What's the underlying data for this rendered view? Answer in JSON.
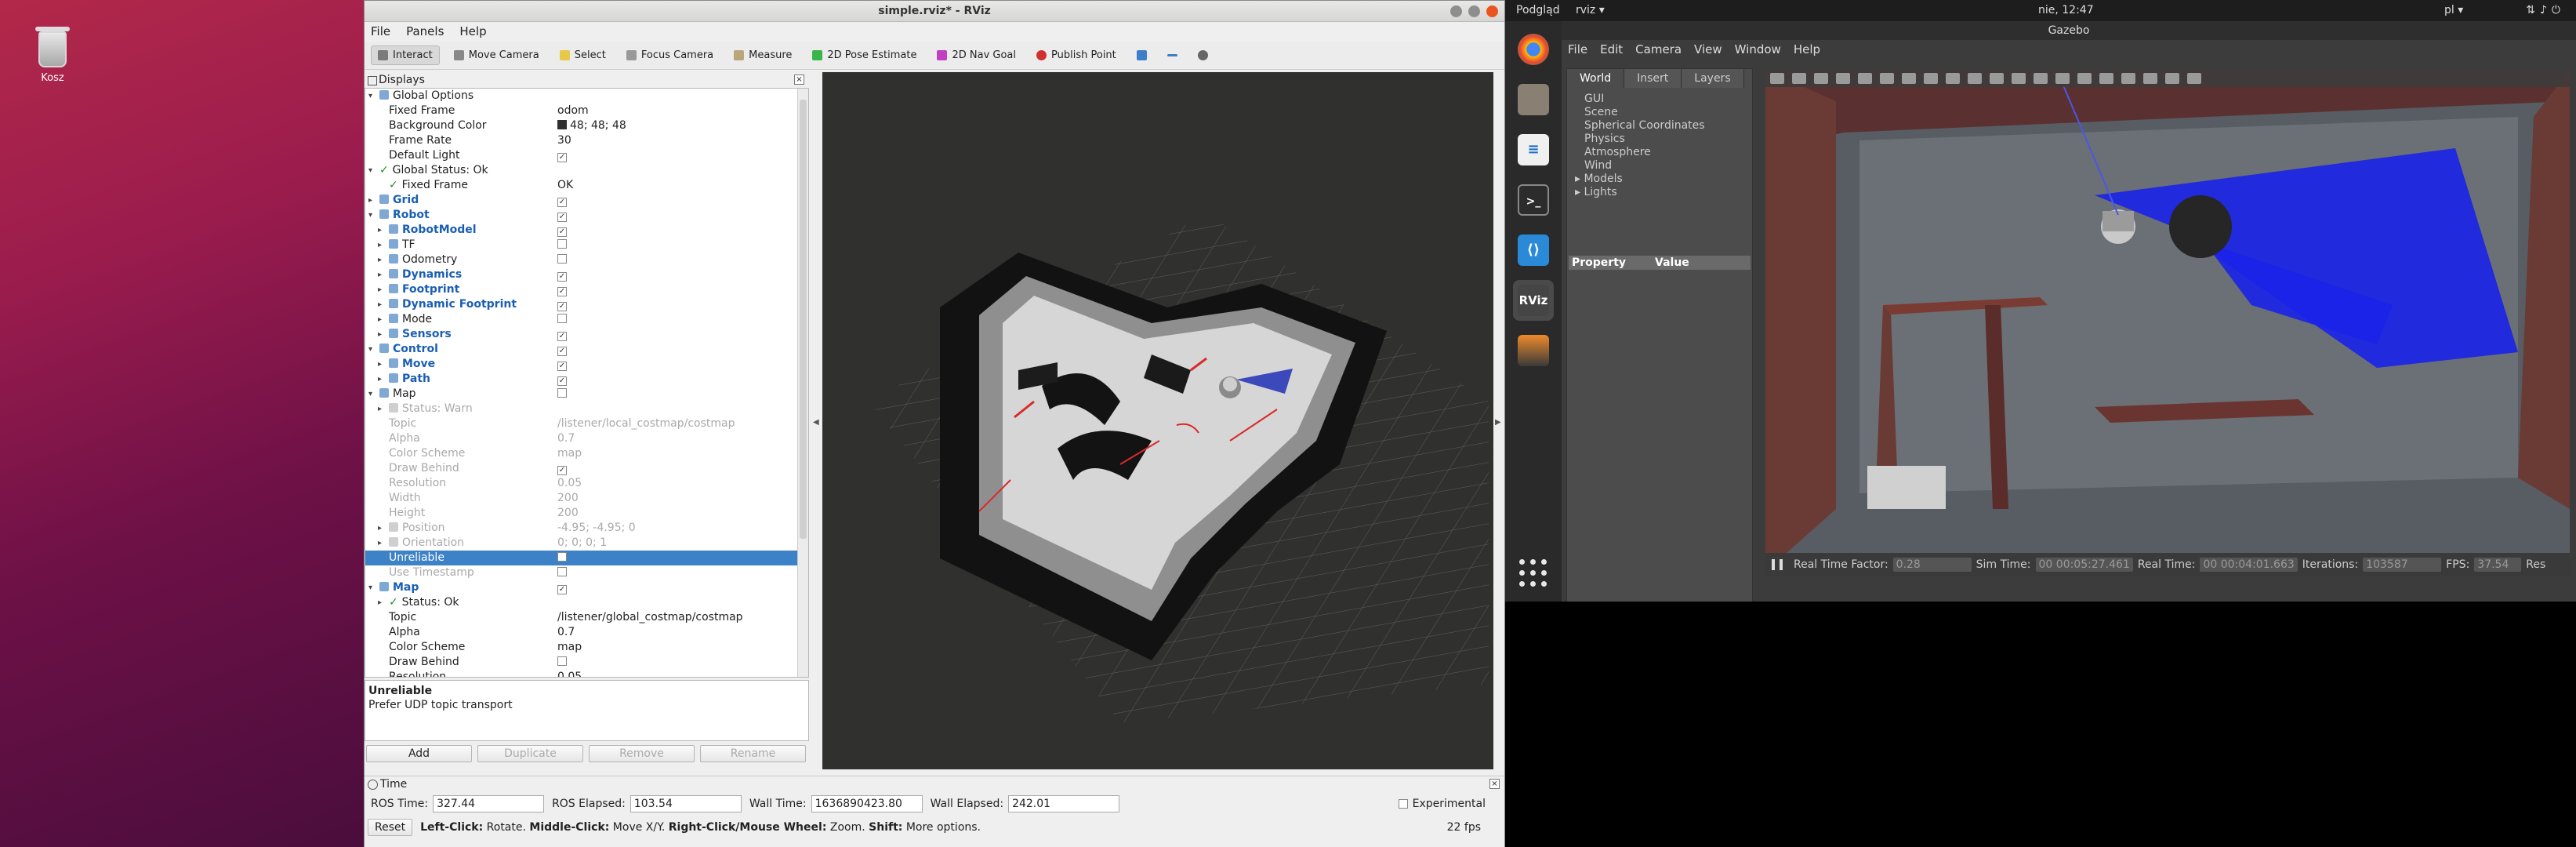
{
  "desktop": {
    "trash_label": "Kosz"
  },
  "rviz": {
    "title": "simple.rviz* - RViz",
    "menu": [
      "File",
      "Panels",
      "Help"
    ],
    "tools": [
      "Interact",
      "Move Camera",
      "Select",
      "Focus Camera",
      "Measure",
      "2D Pose Estimate",
      "2D Nav Goal",
      "Publish Point"
    ],
    "displays_title": "Displays",
    "tree": [
      {
        "name": "Global Options",
        "value": "",
        "indent": 1,
        "exp": "▾",
        "icon": "gear"
      },
      {
        "name": "Fixed Frame",
        "value": "odom",
        "indent": 2
      },
      {
        "name": "Background Color",
        "value": "48; 48; 48",
        "indent": 2,
        "swatch": true
      },
      {
        "name": "Frame Rate",
        "value": "30",
        "indent": 2
      },
      {
        "name": "Default Light",
        "value": "✓",
        "indent": 2,
        "check": true
      },
      {
        "name": "Global Status: Ok",
        "value": "",
        "indent": 1,
        "exp": "▾",
        "ok": true
      },
      {
        "name": "Fixed Frame",
        "value": "OK",
        "indent": 2,
        "ok": true
      },
      {
        "name": "Grid",
        "value": "✓",
        "indent": 1,
        "exp": "▸",
        "bold": true,
        "check": true
      },
      {
        "name": "Robot",
        "value": "✓",
        "indent": 1,
        "exp": "▾",
        "bold": true,
        "check": true
      },
      {
        "name": "RobotModel",
        "value": "✓",
        "indent": 2,
        "exp": "▸",
        "bold": true,
        "check": true
      },
      {
        "name": "TF",
        "value": "",
        "indent": 2,
        "exp": "▸",
        "check": true
      },
      {
        "name": "Odometry",
        "value": "",
        "indent": 2,
        "exp": "▸",
        "check": true
      },
      {
        "name": "Dynamics",
        "value": "✓",
        "indent": 2,
        "exp": "▸",
        "bold": true,
        "check": true
      },
      {
        "name": "Footprint",
        "value": "✓",
        "indent": 2,
        "exp": "▸",
        "bold": true,
        "check": true
      },
      {
        "name": "Dynamic Footprint",
        "value": "✓",
        "indent": 2,
        "exp": "▸",
        "bold": true,
        "check": true
      },
      {
        "name": "Mode",
        "value": "",
        "indent": 2,
        "exp": "▸",
        "check": true
      },
      {
        "name": "Sensors",
        "value": "✓",
        "indent": 2,
        "exp": "▸",
        "bold": true,
        "check": true
      },
      {
        "name": "Control",
        "value": "✓",
        "indent": 1,
        "exp": "▾",
        "bold": true,
        "check": true
      },
      {
        "name": "Move",
        "value": "✓",
        "indent": 2,
        "exp": "▸",
        "bold": true,
        "check": true
      },
      {
        "name": "Path",
        "value": "✓",
        "indent": 2,
        "exp": "▸",
        "bold": true,
        "check": true
      },
      {
        "name": "Map",
        "value": "",
        "indent": 1,
        "exp": "▾",
        "check": true
      },
      {
        "name": "Status: Warn",
        "value": "",
        "indent": 2,
        "exp": "▸",
        "dim": true
      },
      {
        "name": "Topic",
        "value": "/listener/local_costmap/costmap",
        "indent": 2,
        "dim": true
      },
      {
        "name": "Alpha",
        "value": "0.7",
        "indent": 2,
        "dim": true
      },
      {
        "name": "Color Scheme",
        "value": "map",
        "indent": 2,
        "dim": true
      },
      {
        "name": "Draw Behind",
        "value": "✓",
        "indent": 2,
        "dim": true,
        "check": true
      },
      {
        "name": "Resolution",
        "value": "0.05",
        "indent": 2,
        "dim": true
      },
      {
        "name": "Width",
        "value": "200",
        "indent": 2,
        "dim": true
      },
      {
        "name": "Height",
        "value": "200",
        "indent": 2,
        "dim": true
      },
      {
        "name": "Position",
        "value": "-4.95; -4.95; 0",
        "indent": 2,
        "exp": "▸",
        "dim": true
      },
      {
        "name": "Orientation",
        "value": "0; 0; 0; 1",
        "indent": 2,
        "exp": "▸",
        "dim": true
      },
      {
        "name": "Unreliable",
        "value": "",
        "indent": 2,
        "sel": true,
        "check": true
      },
      {
        "name": "Use Timestamp",
        "value": "",
        "indent": 2,
        "dim": true,
        "check": true
      },
      {
        "name": "Map",
        "value": "✓",
        "indent": 1,
        "exp": "▾",
        "bold": true,
        "check": true
      },
      {
        "name": "Status: Ok",
        "value": "",
        "indent": 2,
        "exp": "▸",
        "ok": true
      },
      {
        "name": "Topic",
        "value": "/listener/global_costmap/costmap",
        "indent": 2
      },
      {
        "name": "Alpha",
        "value": "0.7",
        "indent": 2
      },
      {
        "name": "Color Scheme",
        "value": "map",
        "indent": 2
      },
      {
        "name": "Draw Behind",
        "value": "",
        "indent": 2,
        "check": true
      },
      {
        "name": "Resolution",
        "value": "0.05",
        "indent": 2
      }
    ],
    "desc_title": "Unreliable",
    "desc_text": "Prefer UDP topic transport",
    "buttons": {
      "add": "Add",
      "duplicate": "Duplicate",
      "remove": "Remove",
      "rename": "Rename"
    },
    "time": {
      "title": "Time",
      "ros_time_label": "ROS Time:",
      "ros_time": "327.44",
      "ros_elapsed_label": "ROS Elapsed:",
      "ros_elapsed": "103.54",
      "wall_time_label": "Wall Time:",
      "wall_time": "1636890423.80",
      "wall_elapsed_label": "Wall Elapsed:",
      "wall_elapsed": "242.01",
      "experimental": "Experimental"
    },
    "status": {
      "reset": "Reset",
      "hint_lc": "Left-Click:",
      "hint_lc_t": " Rotate. ",
      "hint_mc": "Middle-Click:",
      "hint_mc_t": " Move X/Y. ",
      "hint_rc": "Right-Click/Mouse Wheel:",
      "hint_rc_t": " Zoom. ",
      "hint_sh": "Shift:",
      "hint_sh_t": " More options.",
      "fps": "22 fps"
    }
  },
  "topbar": {
    "activities": "Podgląd",
    "app": "rviz ▾",
    "clock": "nie, 12:47",
    "lang": "pl ▾"
  },
  "dock": [
    "chrome-icon",
    "files-icon",
    "writer-icon",
    "terminal-icon",
    "vscode-icon",
    "rviz-icon",
    "gazebo-icon"
  ],
  "gazebo": {
    "title": "Gazebo",
    "menu": [
      "File",
      "Edit",
      "Camera",
      "View",
      "Window",
      "Help"
    ],
    "tabs": [
      "World",
      "Insert",
      "Layers"
    ],
    "tree": [
      "GUI",
      "Scene",
      "Spherical Coordinates",
      "Physics",
      "Atmosphere",
      "Wind",
      "▸ Models",
      "▸ Lights"
    ],
    "prop_header": [
      "Property",
      "Value"
    ],
    "bottom": {
      "rtf_label": "Real Time Factor:",
      "rtf": "0.28",
      "sim_label": "Sim Time:",
      "sim": "00 00:05:27.461",
      "real_label": "Real Time:",
      "real": "00 00:04:01.663",
      "iter_label": "Iterations:",
      "iter": "103587",
      "fps_label": "FPS:",
      "fps": "37.54",
      "reset": "Res"
    }
  }
}
